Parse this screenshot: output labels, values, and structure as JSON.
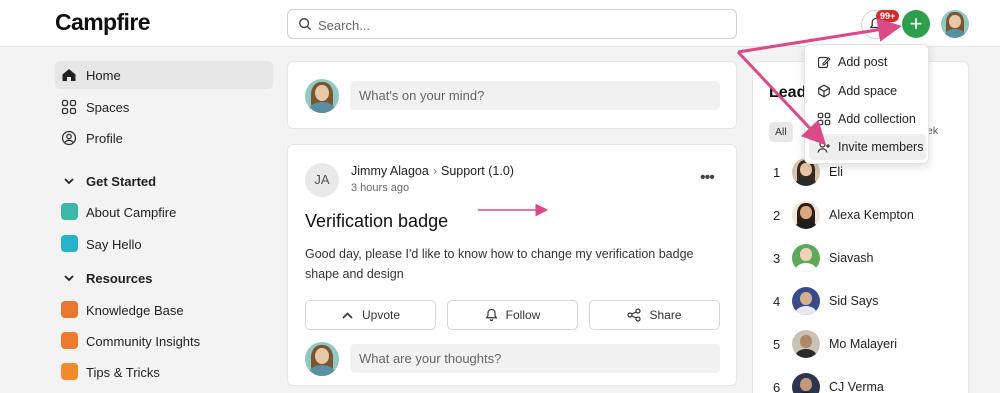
{
  "header": {
    "logo": "Campfire",
    "search_placeholder": "Search...",
    "notification_badge": "99+"
  },
  "sidebar": {
    "items": [
      {
        "label": "Home"
      },
      {
        "label": "Spaces"
      },
      {
        "label": "Profile"
      }
    ],
    "get_started": {
      "heading": "Get Started",
      "items": [
        {
          "label": "About Campfire"
        },
        {
          "label": "Say Hello"
        }
      ]
    },
    "resources": {
      "heading": "Resources",
      "items": [
        {
          "label": "Knowledge Base"
        },
        {
          "label": "Community Insights"
        },
        {
          "label": "Tips & Tricks"
        }
      ]
    }
  },
  "composer": {
    "placeholder": "What's on your mind?"
  },
  "post": {
    "initials": "JA",
    "author": "Jimmy Alagoa",
    "space": "Support (1.0)",
    "time": "3 hours ago",
    "title": "Verification badge",
    "body": "Good day, please I'd like to know how to change my verification badge shape and design",
    "actions": {
      "upvote": "Upvote",
      "follow": "Follow",
      "share": "Share"
    },
    "reply_placeholder": "What are your thoughts?"
  },
  "leaderboard": {
    "title": "Lead",
    "filter_all": "All",
    "filter_week": "ek",
    "entries": [
      {
        "rank": "1",
        "name": "Eli"
      },
      {
        "rank": "2",
        "name": "Alexa Kempton"
      },
      {
        "rank": "3",
        "name": "Siavash"
      },
      {
        "rank": "4",
        "name": "Sid Says"
      },
      {
        "rank": "5",
        "name": "Mo Malayeri"
      },
      {
        "rank": "6",
        "name": "CJ Verma"
      }
    ]
  },
  "create_menu": {
    "items": [
      {
        "label": "Add post"
      },
      {
        "label": "Add space"
      },
      {
        "label": "Add collection"
      },
      {
        "label": "Invite members"
      }
    ]
  },
  "colors": {
    "accent_green": "#2e9e4a",
    "badge_red": "#d42a2a",
    "annotation_pink": "#d94a86"
  }
}
